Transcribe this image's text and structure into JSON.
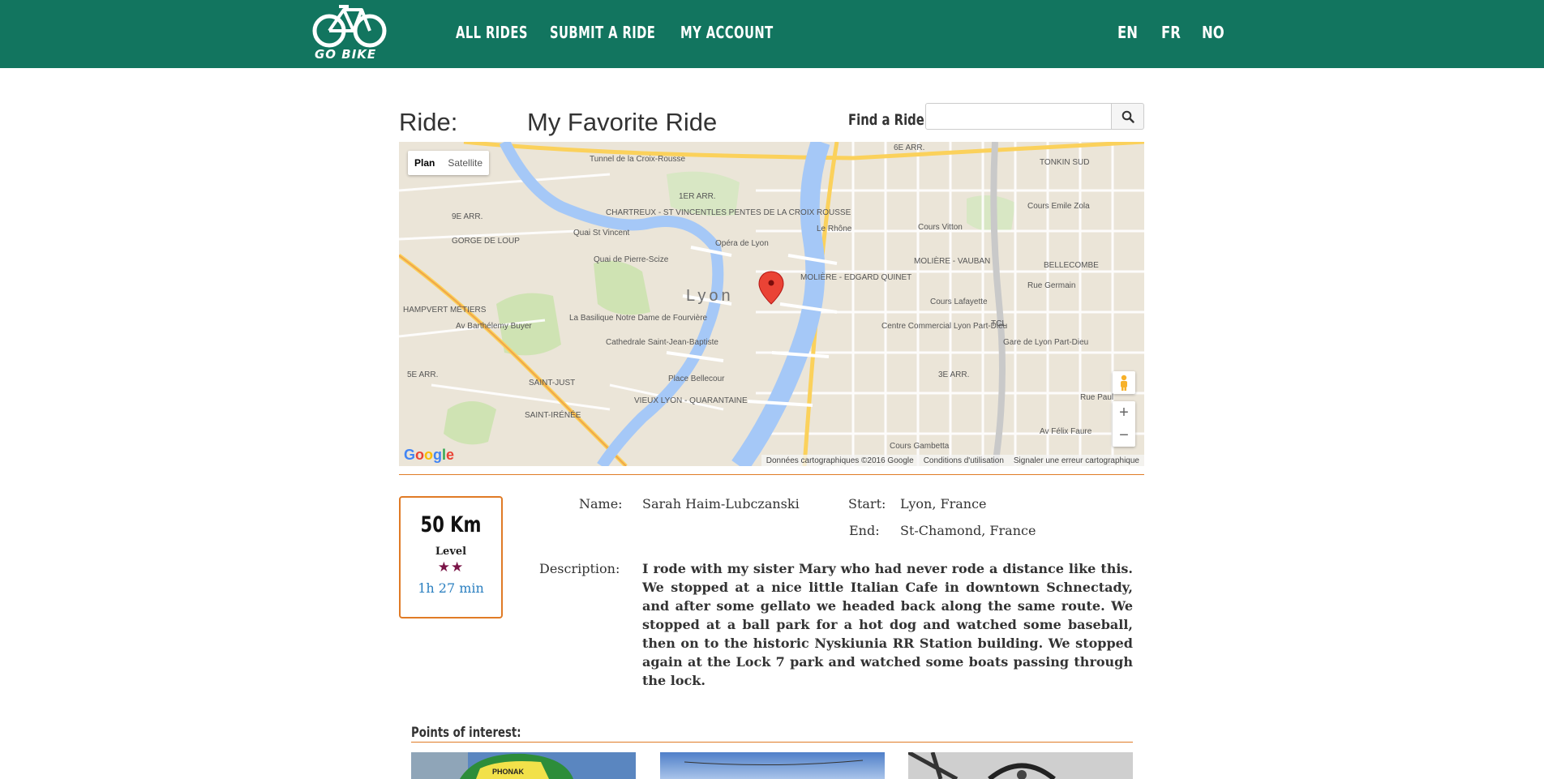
{
  "brand": {
    "logo_text": "GO BIKE",
    "primary_color": "#12755f",
    "accent_color": "#e07b26"
  },
  "nav": {
    "links": [
      "ALL RIDES",
      "SUBMIT A RIDE",
      "MY ACCOUNT"
    ],
    "languages": [
      "EN",
      "FR",
      "NO"
    ]
  },
  "ride": {
    "label": "Ride:",
    "title": "My Favorite Ride"
  },
  "search": {
    "label": "Find a Ride:",
    "value": "",
    "icon": "search-icon"
  },
  "map": {
    "type_buttons": [
      "Plan",
      "Satellite"
    ],
    "active_type": "Plan",
    "city_label": "Lyon",
    "labels": [
      "Tunnel de la Croix-Rousse",
      "1ER ARR.",
      "CHARTREUX - ST VINCENT",
      "LES PENTES DE LA CROIX ROUSSE",
      "9E ARR.",
      "GORGE DE LOUP",
      "Opéra de Lyon",
      "Quai de Pierre-Scize",
      "Quai St Vincent",
      "Le Rhône",
      "MOLIÈRE - EDGARD QUINET",
      "MOLIÈRE - VAUBAN",
      "Cours Vitton",
      "Cours Emile Zola",
      "TONKIN SUD",
      "6E ARR.",
      "BELLECOMBE",
      "Rue Germain",
      "Cours Lafayette",
      "La Basilique Notre Dame de Fourvière",
      "Cathedrale Saint-Jean-Baptiste",
      "Centre Commercial Lyon Part-Dieu",
      "TCL",
      "Gare de Lyon Part-Dieu",
      "Place Bellecour",
      "VIEUX LYON - QUARANTAINE",
      "SAINT-JUST",
      "SAINT-IRÉNÉE",
      "5E ARR.",
      "3E ARR.",
      "HAMPVERT MÉTIERS",
      "Av Barthélemy Buyer",
      "Rue Paul",
      "Av Félix Faure",
      "Cours Gambetta"
    ],
    "attribution": [
      "Données cartographiques ©2016 Google",
      "Conditions d'utilisation",
      "Signaler une erreur cartographique"
    ],
    "zoom_in": "+",
    "zoom_out": "−",
    "google": "Google"
  },
  "stats": {
    "distance": "50 Km",
    "level_label": "Level",
    "level_stars": 2,
    "stars_text": "★★",
    "duration": "1h 27 min"
  },
  "details": {
    "name_label": "Name:",
    "name": "Sarah Haim-Lubczanski",
    "start_label": "Start:",
    "start": "Lyon, France",
    "end_label": "End:",
    "end": "St-Chamond, France",
    "description_label": "Description:",
    "description": "I rode with my sister Mary who had never rode a distance like this. We stopped at a nice little Italian Cafe in downtown Schnectady, and after some gellato we headed back along the same route. We stopped at a ball park for a hot dog and watched some baseball, then on to the historic Nyskiunia RR Station building. We stopped again at the Lock 7 park and watched some boats passing through the lock."
  },
  "points_of_interest": {
    "title": "Points of interest:",
    "jersey_text": "PHONAK"
  }
}
